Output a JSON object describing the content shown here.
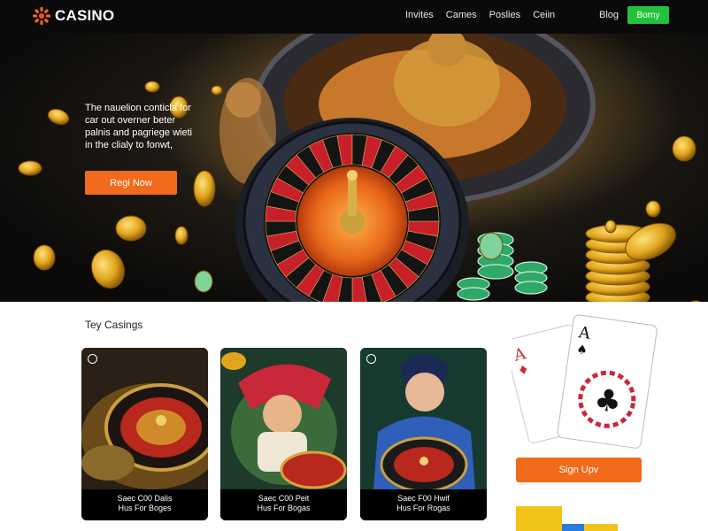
{
  "header": {
    "logo_text": "CASINO",
    "nav": [
      "Invites",
      "Cames",
      "Poslies",
      "Ceiin"
    ],
    "blog_label": "Blog",
    "cta_label": "Borny"
  },
  "hero": {
    "text_lines": [
      "The nauelion conticla for",
      "car out overner beter",
      "palnis and pagriege wieti",
      "in the clialy to fonwt,"
    ],
    "button_label": "Regi Now"
  },
  "section": {
    "title": "Tey Casings"
  },
  "cards": [
    {
      "line1": "Saec C00 Dalis",
      "line2": "Hus For Boges"
    },
    {
      "line1": "Saec C00 Peit",
      "line2": "Hus For Bogas"
    },
    {
      "line1": "Saec F00 Hwif",
      "line2": "Hus For Rogas"
    }
  ],
  "signup_label": "Sign Upv",
  "colors": {
    "accent_orange": "#f26a1b",
    "accent_green": "#22c33a",
    "header_bg": "#0a0a0a",
    "gold": "#d9a21b"
  },
  "icons": [
    "logo-burst-icon",
    "roulette-wheel",
    "gold-coin",
    "chip-stack",
    "playing-card-ace-hearts",
    "playing-card-ace-spades",
    "card-badge-icon"
  ]
}
